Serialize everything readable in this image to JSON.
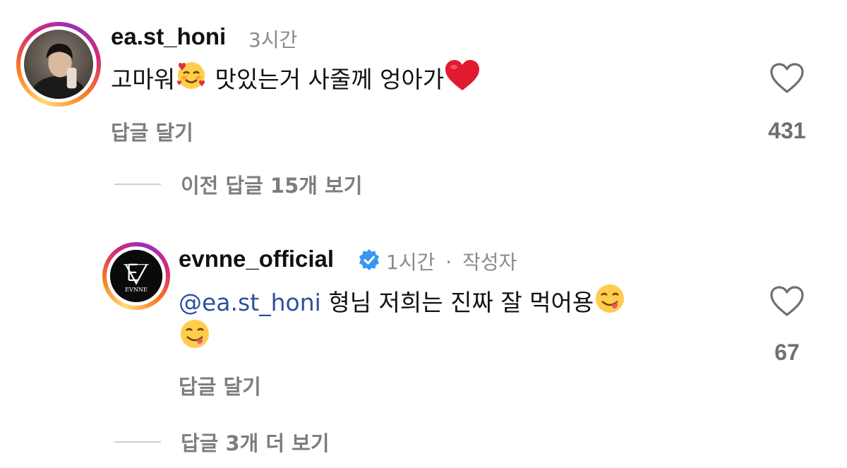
{
  "comments": [
    {
      "username": "ea.st_honi",
      "time": "3시간",
      "text_before": "고마워",
      "emoji_1": "smiling-face-with-hearts",
      "text_after": " 맛있는거 사줄께 엉아가",
      "emoji_2": "red-heart",
      "reply_label": "답글 달기",
      "like_count": "431",
      "view_replies": "이전 답글 15개 보기"
    },
    {
      "username": "evnne_official",
      "verified": true,
      "time": "1시간",
      "separator": "·",
      "author_label": "작성자",
      "mention": "@ea.st_honi",
      "text": " 형님 저희는 진짜 잘 먹어용",
      "emoji": "face-savoring-food",
      "reply_label": "답글 달기",
      "like_count": "67",
      "view_replies": "답글 3개 더 보기",
      "avatar_logo_text": "EVNNE"
    }
  ],
  "colors": {
    "mention": "#2f4fa0",
    "verified": "#3897f0",
    "heart": "#e0245e"
  }
}
